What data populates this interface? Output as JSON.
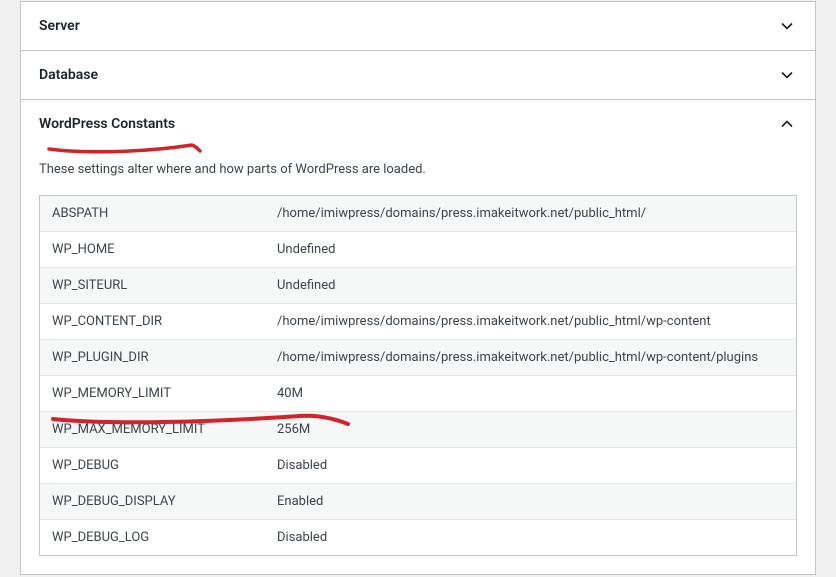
{
  "sections": {
    "server": {
      "title": "Server"
    },
    "database": {
      "title": "Database"
    },
    "constants": {
      "title": "WordPress Constants",
      "description": "These settings alter where and how parts of WordPress are loaded.",
      "rows": [
        {
          "key": "ABSPATH",
          "val": "/home/imiwpress/domains/press.imakeitwork.net/public_html/"
        },
        {
          "key": "WP_HOME",
          "val": "Undefined"
        },
        {
          "key": "WP_SITEURL",
          "val": "Undefined"
        },
        {
          "key": "WP_CONTENT_DIR",
          "val": "/home/imiwpress/domains/press.imakeitwork.net/public_html/wp-content"
        },
        {
          "key": "WP_PLUGIN_DIR",
          "val": "/home/imiwpress/domains/press.imakeitwork.net/public_html/wp-content/plugins"
        },
        {
          "key": "WP_MEMORY_LIMIT",
          "val": "40M"
        },
        {
          "key": "WP_MAX_MEMORY_LIMIT",
          "val": "256M"
        },
        {
          "key": "WP_DEBUG",
          "val": "Disabled"
        },
        {
          "key": "WP_DEBUG_DISPLAY",
          "val": "Enabled"
        },
        {
          "key": "WP_DEBUG_LOG",
          "val": "Disabled"
        }
      ]
    }
  }
}
